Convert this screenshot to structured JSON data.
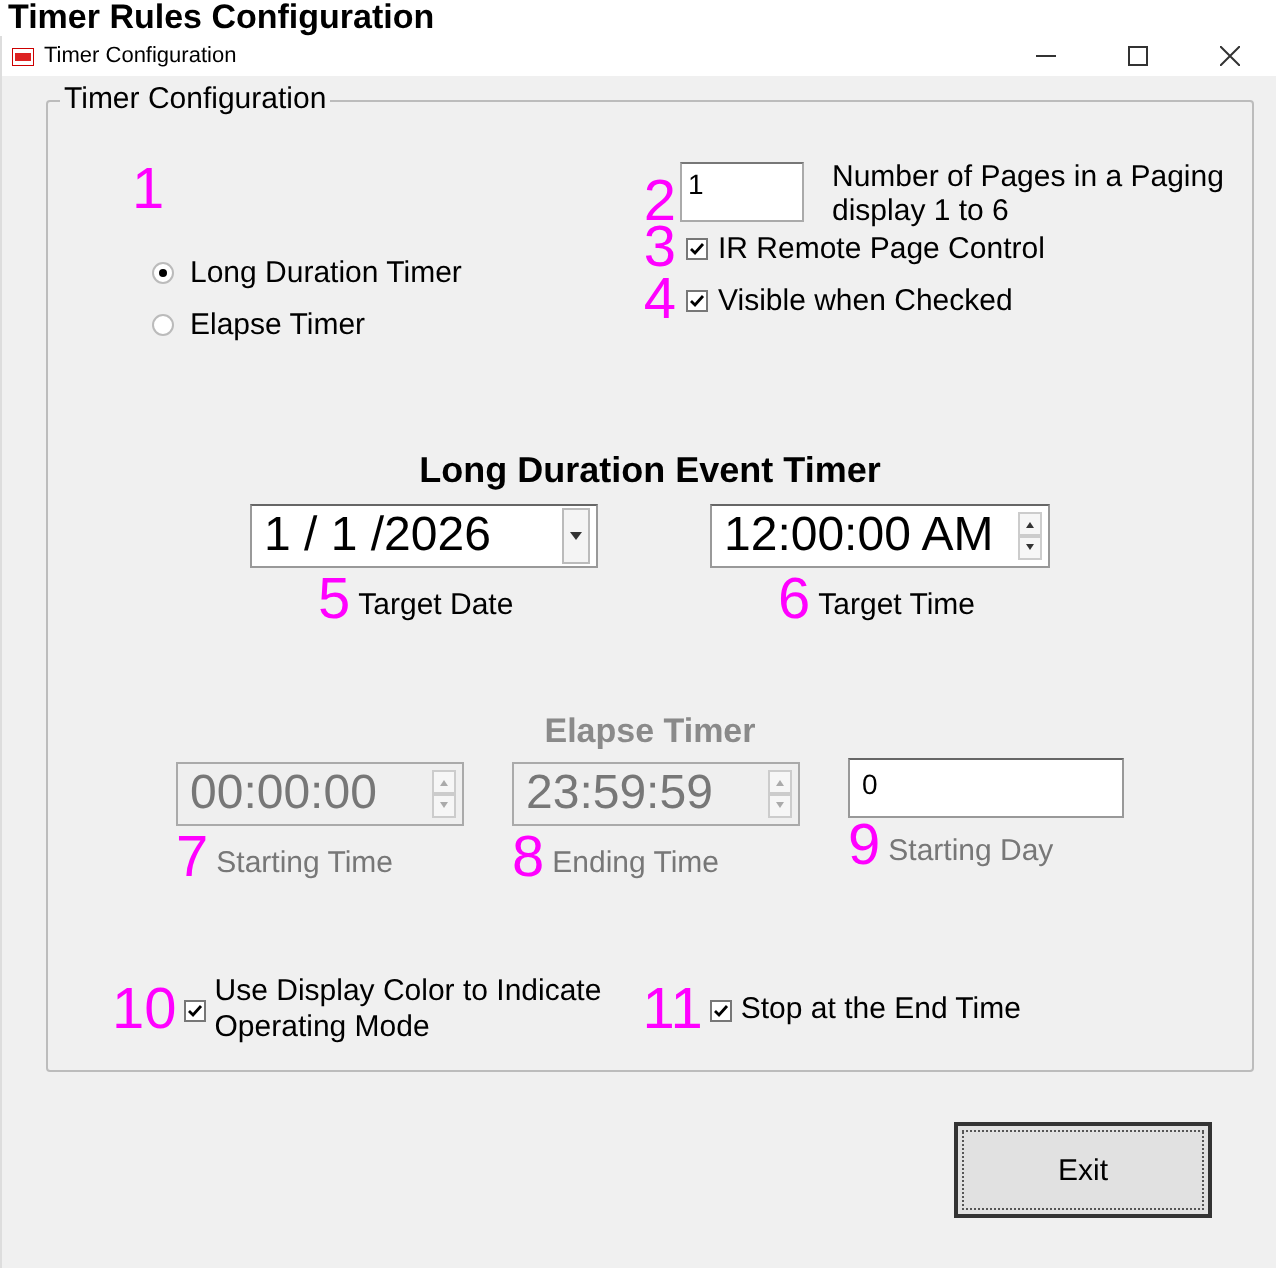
{
  "page_heading": "Timer Rules Configuration",
  "window": {
    "title": "Timer Configuration"
  },
  "group": {
    "title": "Timer Configuration"
  },
  "timer_mode": {
    "annotation": "1",
    "options": [
      {
        "label": "Long Duration Timer",
        "selected": true
      },
      {
        "label": "Elapse Timer",
        "selected": false
      }
    ]
  },
  "pages": {
    "annotation": "2",
    "value": "1",
    "label": "Number of Pages in a Paging display 1 to 6"
  },
  "options": [
    {
      "annotation": "3",
      "label": "IR Remote Page Control",
      "checked": true
    },
    {
      "annotation": "4",
      "label": "Visible when Checked",
      "checked": true
    }
  ],
  "long_duration": {
    "title": "Long Duration Event Timer",
    "fields": [
      {
        "annotation": "5",
        "kind": "date",
        "value": "1 / 1 /2026",
        "label": "Target Date"
      },
      {
        "annotation": "6",
        "kind": "spinner",
        "value": "12:00:00 AM",
        "label": "Target Time"
      }
    ]
  },
  "elapse": {
    "title": "Elapse Timer",
    "disabled": true,
    "fields": [
      {
        "annotation": "7",
        "kind": "spinner",
        "value": "00:00:00",
        "label": "Starting Time",
        "disabled": true
      },
      {
        "annotation": "8",
        "kind": "spinner",
        "value": "23:59:59",
        "label": "Ending Time",
        "disabled": true
      },
      {
        "annotation": "9",
        "kind": "text",
        "value": "0",
        "label": "Starting Day",
        "disabled": false
      }
    ]
  },
  "bottom_options": [
    {
      "annotation": "10",
      "label": "Use Display Color to Indicate Operating Mode",
      "checked": true
    },
    {
      "annotation": "11",
      "label": "Stop at the End Time",
      "checked": true
    }
  ],
  "buttons": [
    {
      "label": "Exit"
    }
  ]
}
